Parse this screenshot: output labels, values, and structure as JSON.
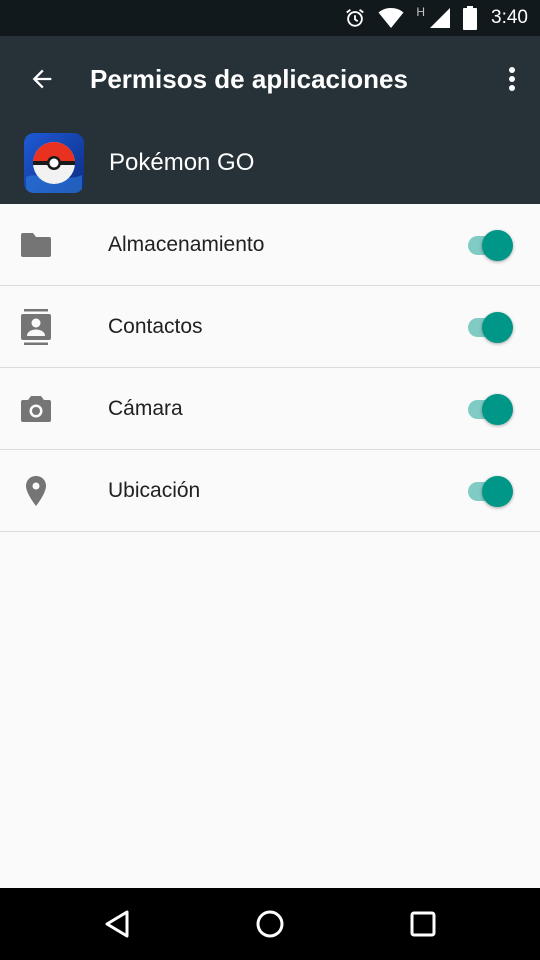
{
  "status_bar": {
    "time": "3:40",
    "network_type": "H",
    "icons": [
      "alarm-icon",
      "wifi-icon",
      "signal-icon",
      "battery-icon"
    ]
  },
  "app_bar": {
    "title": "Permisos de aplicaciones",
    "back_icon": "arrow-back-icon",
    "menu_icon": "more-vert-icon"
  },
  "app": {
    "name": "Pokémon GO",
    "icon": "pokeball-app-icon"
  },
  "permissions": [
    {
      "label": "Almacenamiento",
      "icon": "folder-icon",
      "enabled": true
    },
    {
      "label": "Contactos",
      "icon": "contacts-icon",
      "enabled": true
    },
    {
      "label": "Cámara",
      "icon": "camera-icon",
      "enabled": true
    },
    {
      "label": "Ubicación",
      "icon": "location-icon",
      "enabled": true
    }
  ],
  "colors": {
    "app_bar": "#263238",
    "status_bar": "#12191c",
    "toggle_on": "#009688",
    "toggle_track": "#80cbc4"
  }
}
